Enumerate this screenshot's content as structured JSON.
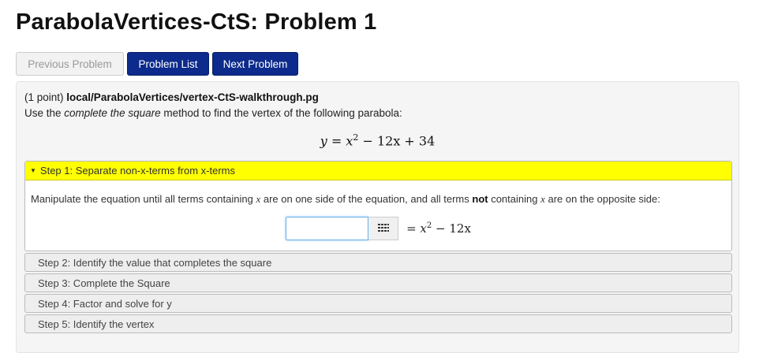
{
  "page": {
    "title": "ParabolaVertices-CtS: Problem 1"
  },
  "nav": {
    "previous": "Previous Problem",
    "list": "Problem List",
    "next": "Next Problem"
  },
  "problem": {
    "points": "(1 point)",
    "path": "local/ParabolaVertices/vertex-CtS-walkthrough.pg",
    "instruction_pre": "Use the ",
    "instruction_em": "complete the square",
    "instruction_post": " method to find the vertex of the following parabola:",
    "equation": {
      "lhs": "y",
      "eq": " = ",
      "x": "x",
      "exp": "2",
      "rest": " − 12x + 34"
    }
  },
  "steps": [
    {
      "label": "Step 1: Separate non-x-terms from x-terms",
      "expanded": true,
      "body": {
        "t1": "Manipulate the equation until all terms containing ",
        "var1": "x",
        "t2": " are on one side of the equation, and all terms ",
        "bold": "not",
        "t3": " containing ",
        "var2": "x",
        "t4": " are on the opposite side:"
      },
      "answer": {
        "value": "",
        "rhs_prefix": "= ",
        "rhs_x": "x",
        "rhs_exp": "2",
        "rhs_rest": " − 12x"
      }
    },
    {
      "label": "Step 2: Identify the value that completes the square",
      "expanded": false
    },
    {
      "label": "Step 3: Complete the Square",
      "expanded": false
    },
    {
      "label": "Step 4: Factor and solve for y",
      "expanded": false
    },
    {
      "label": "Step 5: Identify the vertex",
      "expanded": false
    }
  ],
  "icons": {
    "palette": "grid-icon",
    "caret": "caret-down-icon"
  },
  "colors": {
    "primary": "#0d2b8c",
    "step_highlight": "#ffff00"
  }
}
